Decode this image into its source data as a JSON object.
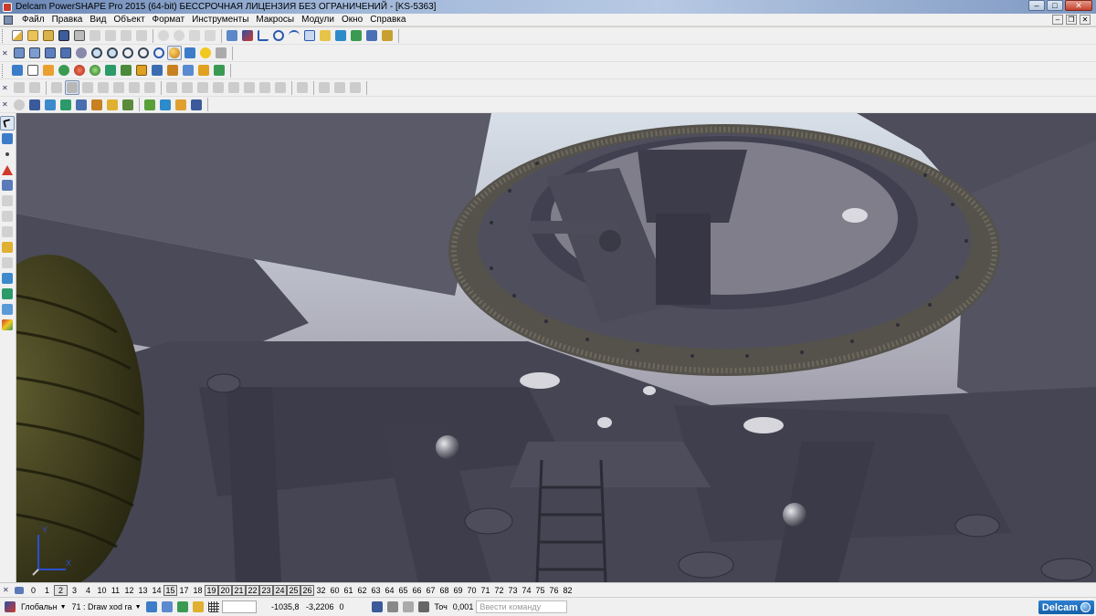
{
  "titlebar": {
    "title": "Delcam PowerSHAPE Pro 2015 (64-bit) БЕССРОЧНАЯ ЛИЦЕНЗИЯ БЕЗ ОГРАНИЧЕНИЙ - [KS-5363]"
  },
  "menu": [
    "Файл",
    "Правка",
    "Вид",
    "Объект",
    "Формат",
    "Инструменты",
    "Макросы",
    "Модули",
    "Окно",
    "Справка"
  ],
  "levels": {
    "items": [
      "0",
      "1",
      "2",
      "3",
      "4",
      "10",
      "11",
      "12",
      "13",
      "14",
      "15",
      "17",
      "18",
      "19",
      "20",
      "21",
      "22",
      "23",
      "24",
      "25",
      "26",
      "32",
      "60",
      "61",
      "62",
      "63",
      "64",
      "65",
      "66",
      "67",
      "68",
      "69",
      "70",
      "71",
      "72",
      "73",
      "74",
      "75",
      "76",
      "82"
    ],
    "highlighted": [
      "2",
      "15",
      "19",
      "20",
      "21",
      "22",
      "23",
      "24",
      "25",
      "26"
    ]
  },
  "status": {
    "workplane": "Глобальн",
    "level_select": "71 : Draw xod ra",
    "coord_x": "-1035,8",
    "coord_y": "-3,2206",
    "coord_z": "0",
    "tolerance_label": "Точ",
    "tolerance_value": "0,001",
    "command_placeholder": "Ввести команду",
    "logo": "Delcam"
  },
  "axis": {
    "x": "X",
    "y": "Y"
  },
  "colors": {
    "title_gradient_start": "#6a86b4",
    "toolbar_bg": "#f0f0f0",
    "model_steel": "#4a4a58",
    "tire": "#3b3a1e",
    "viewport_bg": "#9a98a4",
    "logo_blue": "#1560a8"
  }
}
